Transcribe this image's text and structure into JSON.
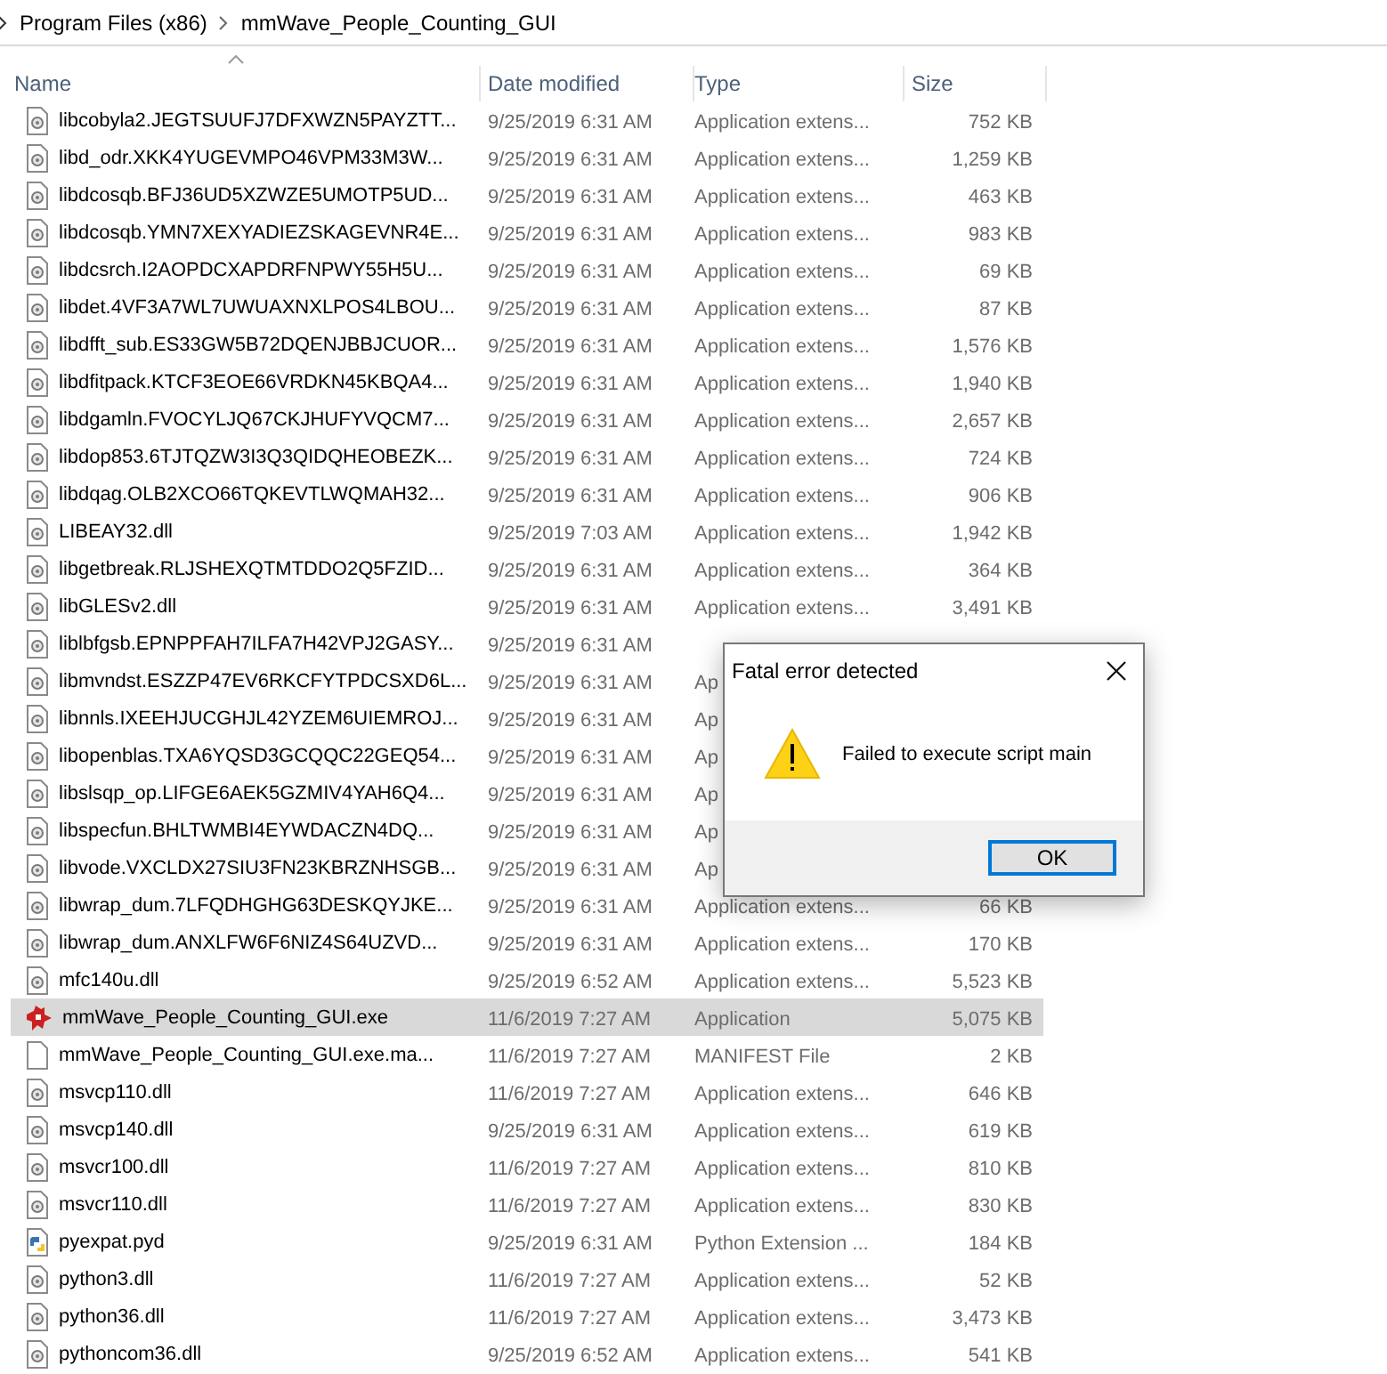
{
  "breadcrumb": [
    "Program Files (x86)",
    "mmWave_People_Counting_GUI"
  ],
  "columns": [
    {
      "label": "Name",
      "sorted": true
    },
    {
      "label": "Date modified",
      "sorted": false
    },
    {
      "label": "Type",
      "sorted": false
    },
    {
      "label": "Size",
      "sorted": false
    }
  ],
  "files": [
    {
      "kind": "dll",
      "name": "libcobyla2.JEGTSUUFJ7DFXWZN5PAYZTT...",
      "date": "9/25/2019 6:31 AM",
      "type": "Application extens...",
      "size": "752 KB",
      "selected": false
    },
    {
      "kind": "dll",
      "name": "libd_odr.XKK4YUGEVMPO46VPM33M3W...",
      "date": "9/25/2019 6:31 AM",
      "type": "Application extens...",
      "size": "1,259 KB",
      "selected": false
    },
    {
      "kind": "dll",
      "name": "libdcosqb.BFJ36UD5XZWZE5UMOTP5UD...",
      "date": "9/25/2019 6:31 AM",
      "type": "Application extens...",
      "size": "463 KB",
      "selected": false
    },
    {
      "kind": "dll",
      "name": "libdcosqb.YMN7XEXYADIEZSKAGEVNR4E...",
      "date": "9/25/2019 6:31 AM",
      "type": "Application extens...",
      "size": "983 KB",
      "selected": false
    },
    {
      "kind": "dll",
      "name": "libdcsrch.I2AOPDCXAPDRFNPWY55H5U...",
      "date": "9/25/2019 6:31 AM",
      "type": "Application extens...",
      "size": "69 KB",
      "selected": false
    },
    {
      "kind": "dll",
      "name": "libdet.4VF3A7WL7UWUAXNXLPOS4LBOU...",
      "date": "9/25/2019 6:31 AM",
      "type": "Application extens...",
      "size": "87 KB",
      "selected": false
    },
    {
      "kind": "dll",
      "name": "libdfft_sub.ES33GW5B72DQENJBBJCUOR...",
      "date": "9/25/2019 6:31 AM",
      "type": "Application extens...",
      "size": "1,576 KB",
      "selected": false
    },
    {
      "kind": "dll",
      "name": "libdfitpack.KTCF3EOE66VRDKN45KBQA4...",
      "date": "9/25/2019 6:31 AM",
      "type": "Application extens...",
      "size": "1,940 KB",
      "selected": false
    },
    {
      "kind": "dll",
      "name": "libdgamln.FVOCYLJQ67CKJHUFYVQCM7...",
      "date": "9/25/2019 6:31 AM",
      "type": "Application extens...",
      "size": "2,657 KB",
      "selected": false
    },
    {
      "kind": "dll",
      "name": "libdop853.6TJTQZW3I3Q3QIDQHEOBEZK...",
      "date": "9/25/2019 6:31 AM",
      "type": "Application extens...",
      "size": "724 KB",
      "selected": false
    },
    {
      "kind": "dll",
      "name": "libdqag.OLB2XCO66TQKEVTLWQMAH32...",
      "date": "9/25/2019 6:31 AM",
      "type": "Application extens...",
      "size": "906 KB",
      "selected": false
    },
    {
      "kind": "dll",
      "name": "LIBEAY32.dll",
      "date": "9/25/2019 7:03 AM",
      "type": "Application extens...",
      "size": "1,942 KB",
      "selected": false
    },
    {
      "kind": "dll",
      "name": "libgetbreak.RLJSHEXQTMTDDO2Q5FZID...",
      "date": "9/25/2019 6:31 AM",
      "type": "Application extens...",
      "size": "364 KB",
      "selected": false
    },
    {
      "kind": "dll",
      "name": "libGLESv2.dll",
      "date": "9/25/2019 6:31 AM",
      "type": "Application extens...",
      "size": "3,491 KB",
      "selected": false
    },
    {
      "kind": "dll",
      "name": "liblbfgsb.EPNPPFAH7ILFA7H42VPJ2GASY...",
      "date": "9/25/2019 6:31 AM",
      "selected": false
    },
    {
      "kind": "dll",
      "name": "libmvndst.ESZZP47EV6RKCFYTPDCSXD6L...",
      "date": "9/25/2019 6:31 AM",
      "type": "Ap",
      "selected": false
    },
    {
      "kind": "dll",
      "name": "libnnls.IXEEHJUCGHJL42YZEM6UIEMROJ...",
      "date": "9/25/2019 6:31 AM",
      "type": "Ap",
      "selected": false
    },
    {
      "kind": "dll",
      "name": "libopenblas.TXA6YQSD3GCQQC22GEQ54...",
      "date": "9/25/2019 6:31 AM",
      "type": "Ap",
      "selected": false
    },
    {
      "kind": "dll",
      "name": "libslsqp_op.LIFGE6AEK5GZMIV4YAH6Q4...",
      "date": "9/25/2019 6:31 AM",
      "type": "Ap",
      "selected": false
    },
    {
      "kind": "dll",
      "name": "libspecfun.BHLTWMBI4EYWDACZN4DQ...",
      "date": "9/25/2019 6:31 AM",
      "type": "Ap",
      "selected": false
    },
    {
      "kind": "dll",
      "name": "libvode.VXCLDX27SIU3FN23KBRZNHSGB...",
      "date": "9/25/2019 6:31 AM",
      "type": "Ap",
      "selected": false
    },
    {
      "kind": "dll",
      "name": "libwrap_dum.7LFQDHGHG63DESKQYJKE...",
      "date": "9/25/2019 6:31 AM",
      "type": "Application extens...",
      "size": "66 KB",
      "selected": false
    },
    {
      "kind": "dll",
      "name": "libwrap_dum.ANXLFW6F6NIZ4S64UZVD...",
      "date": "9/25/2019 6:31 AM",
      "type": "Application extens...",
      "size": "170 KB",
      "selected": false
    },
    {
      "kind": "dll",
      "name": "mfc140u.dll",
      "date": "9/25/2019 6:52 AM",
      "type": "Application extens...",
      "size": "5,523 KB",
      "selected": false
    },
    {
      "kind": "exe",
      "name": "mmWave_People_Counting_GUI.exe",
      "date": "11/6/2019 7:27 AM",
      "type": "Application",
      "size": "5,075 KB",
      "selected": true
    },
    {
      "kind": "blank",
      "name": "mmWave_People_Counting_GUI.exe.ma...",
      "date": "11/6/2019 7:27 AM",
      "type": "MANIFEST File",
      "size": "2 KB",
      "selected": false
    },
    {
      "kind": "dll",
      "name": "msvcp110.dll",
      "date": "11/6/2019 7:27 AM",
      "type": "Application extens...",
      "size": "646 KB",
      "selected": false
    },
    {
      "kind": "dll",
      "name": "msvcp140.dll",
      "date": "9/25/2019 6:31 AM",
      "type": "Application extens...",
      "size": "619 KB",
      "selected": false
    },
    {
      "kind": "dll",
      "name": "msvcr100.dll",
      "date": "11/6/2019 7:27 AM",
      "type": "Application extens...",
      "size": "810 KB",
      "selected": false
    },
    {
      "kind": "dll",
      "name": "msvcr110.dll",
      "date": "11/6/2019 7:27 AM",
      "type": "Application extens...",
      "size": "830 KB",
      "selected": false
    },
    {
      "kind": "python",
      "name": "pyexpat.pyd",
      "date": "9/25/2019 6:31 AM",
      "type": "Python Extension ...",
      "size": "184 KB",
      "selected": false
    },
    {
      "kind": "dll",
      "name": "python3.dll",
      "date": "11/6/2019 7:27 AM",
      "type": "Application extens...",
      "size": "52 KB",
      "selected": false
    },
    {
      "kind": "dll",
      "name": "python36.dll",
      "date": "11/6/2019 7:27 AM",
      "type": "Application extens...",
      "size": "3,473 KB",
      "selected": false
    },
    {
      "kind": "dll",
      "name": "pythoncom36.dll",
      "date": "9/25/2019 6:52 AM",
      "type": "Application extens...",
      "size": "541 KB",
      "selected": false
    }
  ],
  "dialog": {
    "title": "Fatal error detected",
    "message": "Failed to execute script main",
    "button": "OK"
  }
}
